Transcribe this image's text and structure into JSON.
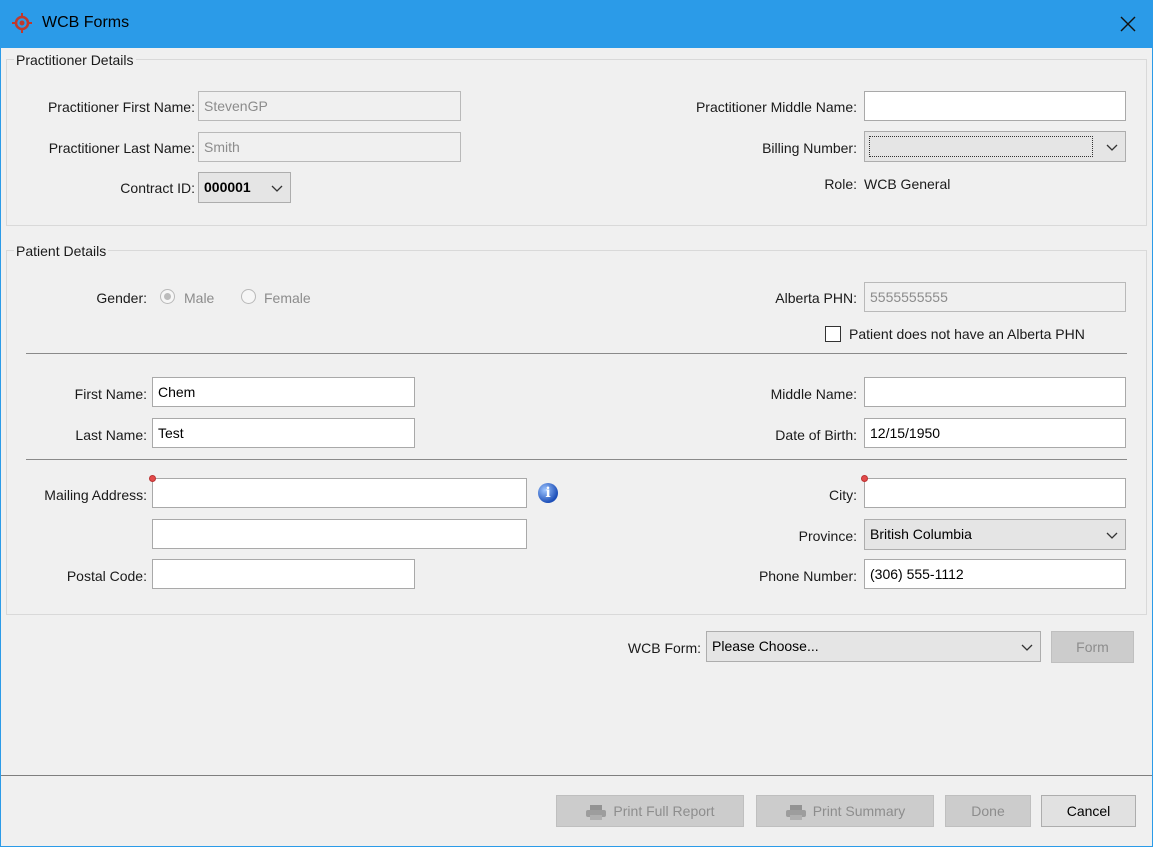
{
  "window": {
    "title": "WCB Forms"
  },
  "practitioner": {
    "legend": "Practitioner Details",
    "first_name_label": "Practitioner First Name:",
    "first_name_value": "StevenGP",
    "last_name_label": "Practitioner Last Name:",
    "last_name_value": "Smith",
    "contract_label": "Contract ID:",
    "contract_value": "000001",
    "middle_name_label": "Practitioner Middle Name:",
    "middle_name_value": "",
    "billing_label": "Billing Number:",
    "billing_value": "",
    "role_label": "Role:",
    "role_value": "WCB General"
  },
  "patient": {
    "legend": "Patient Details",
    "gender_label": "Gender:",
    "gender_options": [
      "Male",
      "Female"
    ],
    "gender_selected": "Male",
    "phn_label": "Alberta PHN:",
    "phn_value": "5555555555",
    "no_phn_label": "Patient does not have an Alberta PHN",
    "no_phn_checked": false,
    "first_name_label": "First Name:",
    "first_name_value": "Chem",
    "last_name_label": "Last Name:",
    "last_name_value": "Test",
    "middle_name_label": "Middle Name:",
    "middle_name_value": "",
    "dob_label": "Date of Birth:",
    "dob_value": "12/15/1950",
    "address_label": "Mailing Address:",
    "address_line1": "",
    "address_line2": "",
    "postal_label": "Postal Code:",
    "postal_value": "",
    "city_label": "City:",
    "city_value": "",
    "province_label": "Province:",
    "province_value": "British Columbia",
    "phone_label": "Phone Number:",
    "phone_value": "(306) 555-1112"
  },
  "wcb": {
    "form_label": "WCB Form:",
    "form_value": "Please Choose...",
    "form_button": "Form"
  },
  "footer": {
    "print_full": "Print Full Report",
    "print_summary": "Print Summary",
    "done": "Done",
    "cancel": "Cancel"
  },
  "colors": {
    "titlebar": "#2b9be8",
    "window_bg": "#f0f0f0",
    "required_marker": "#e34a4a",
    "info_icon": "#1d4fb8"
  },
  "icons": [
    "wcb-app-icon",
    "close-icon",
    "chevron-down-icon",
    "info-icon",
    "printer-icon"
  ]
}
